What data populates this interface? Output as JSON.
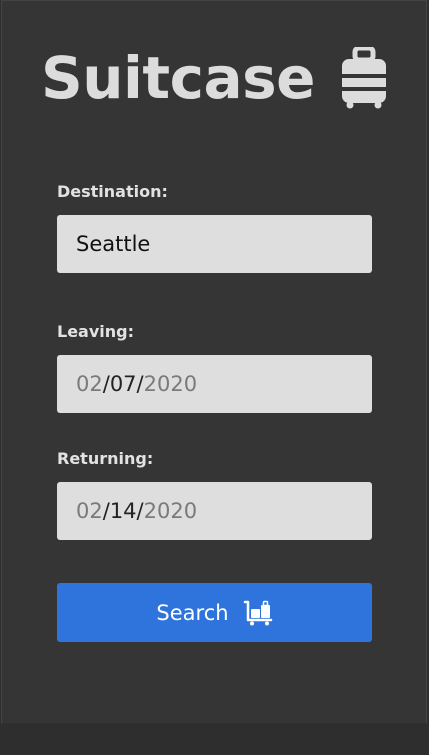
{
  "app": {
    "title": "Suitcase",
    "logo_icon": "suitcase-icon"
  },
  "form": {
    "destination": {
      "label": "Destination:",
      "value": "Seattle"
    },
    "leaving": {
      "label": "Leaving:",
      "month": "02",
      "day": "07",
      "year": "2020",
      "separator": "/"
    },
    "returning": {
      "label": "Returning:",
      "month": "02",
      "day": "14",
      "year": "2020",
      "separator": "/"
    },
    "search_button": {
      "label": "Search",
      "icon": "luggage-cart-icon"
    }
  },
  "colors": {
    "background": "#353535",
    "field_background": "#dedede",
    "accent": "#2f74dc",
    "title_text": "#dcdcdc"
  }
}
